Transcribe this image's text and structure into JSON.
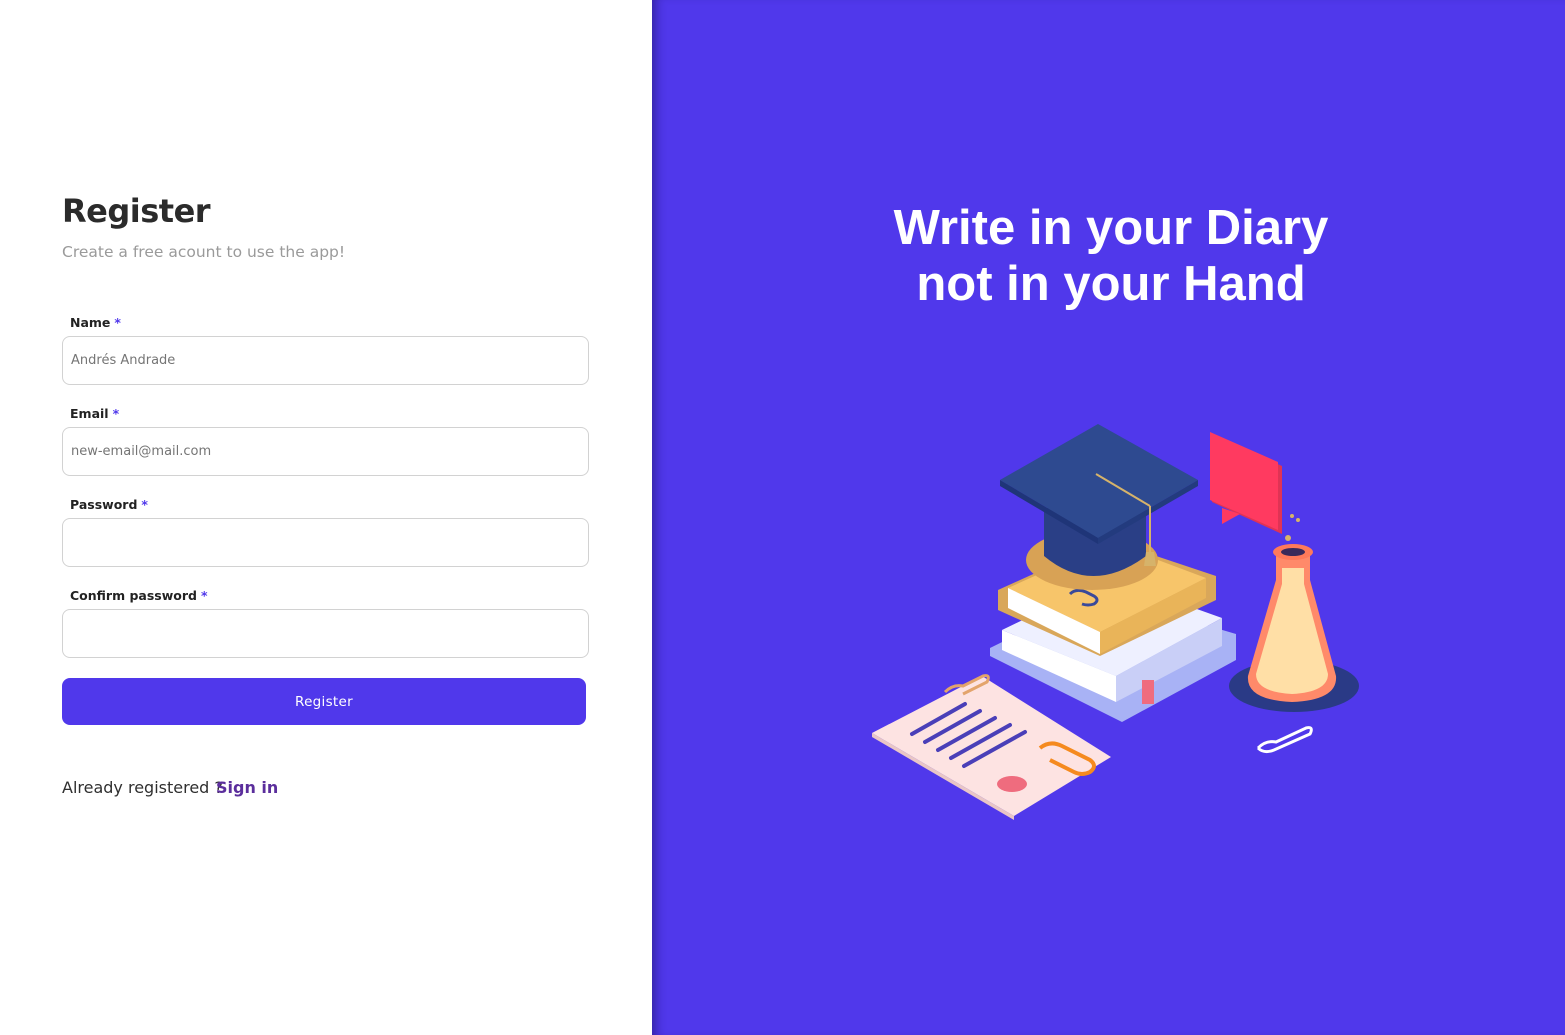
{
  "form": {
    "title": "Register",
    "subtitle": "Create a free acount to use the app!",
    "fields": [
      {
        "label": "Name",
        "required_mark": "*",
        "placeholder": "Andrés Andrade",
        "value": ""
      },
      {
        "label": "Email",
        "required_mark": "*",
        "placeholder": "new-email@mail.com",
        "value": ""
      },
      {
        "label": "Password",
        "required_mark": "*",
        "placeholder": "",
        "value": ""
      },
      {
        "label": "Confirm password",
        "required_mark": "*",
        "placeholder": "",
        "value": ""
      }
    ],
    "submit_label": "Register",
    "already_text": "Already registered ?",
    "signin_label": "Sign in"
  },
  "hero": {
    "line1": "Write in your Diary",
    "line2": "not in your Hand",
    "illustration_icon": "graduation-books-illustration"
  },
  "colors": {
    "accent": "#5038eb",
    "signin_link": "#5b2e9c"
  }
}
